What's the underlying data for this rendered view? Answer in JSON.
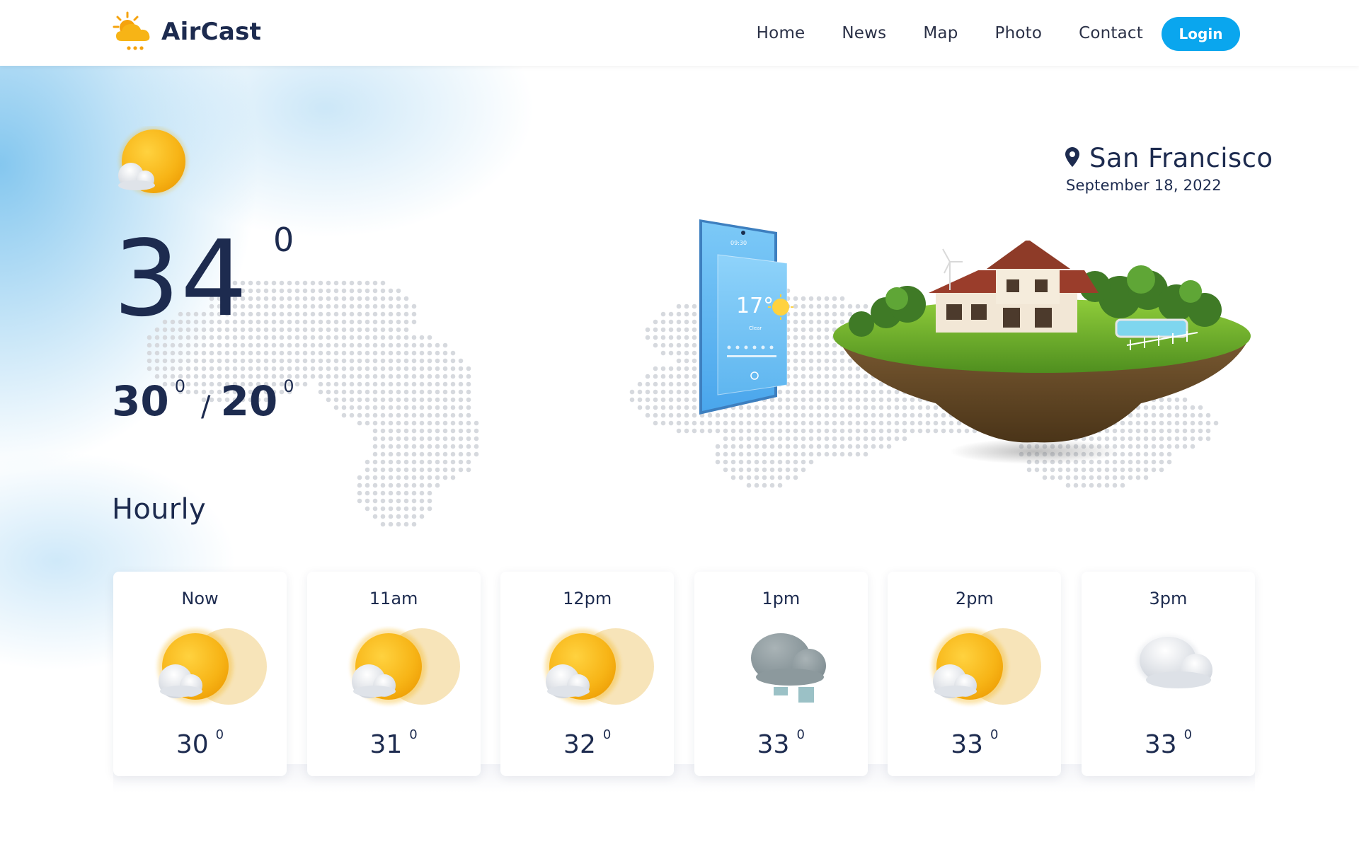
{
  "header": {
    "brand": "AirCast",
    "nav": [
      "Home",
      "News",
      "Map",
      "Photo",
      "Contact"
    ],
    "login_label": "Login"
  },
  "current": {
    "condition_icon": "partly-cloudy-icon",
    "temp": "34",
    "temp_unit": "0",
    "high": "30",
    "high_unit": "0",
    "range_separator": "/",
    "low": "20",
    "low_unit": "0"
  },
  "location": {
    "city": "San Francisco",
    "date": "September 18, 2022"
  },
  "phone": {
    "temp": "17°",
    "condition": "Clear"
  },
  "hourly": {
    "title": "Hourly",
    "items": [
      {
        "time": "Now",
        "icon": "partly-cloudy-icon",
        "temp": "30",
        "unit": "0"
      },
      {
        "time": "11am",
        "icon": "partly-cloudy-icon",
        "temp": "31",
        "unit": "0"
      },
      {
        "time": "12pm",
        "icon": "partly-cloudy-icon",
        "temp": "32",
        "unit": "0"
      },
      {
        "time": "1pm",
        "icon": "rain-cloud-icon",
        "temp": "33",
        "unit": "0"
      },
      {
        "time": "2pm",
        "icon": "partly-cloudy-icon",
        "temp": "33",
        "unit": "0"
      },
      {
        "time": "3pm",
        "icon": "cloudy-icon",
        "temp": "33",
        "unit": "0"
      }
    ]
  },
  "colors": {
    "brand_blue": "#0aa6ee",
    "text_navy": "#1d2b4f",
    "sun_yellow": "#f5b20f",
    "sun_glow": "#f6dfad"
  }
}
